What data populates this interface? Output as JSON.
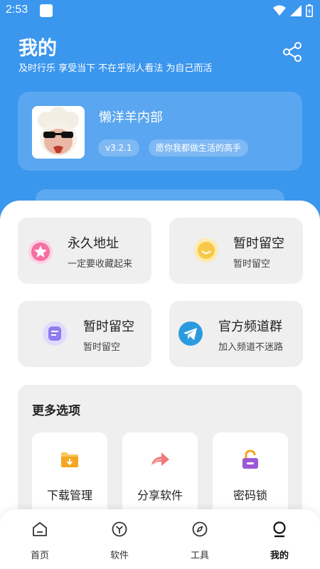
{
  "status_bar": {
    "time": "2:53"
  },
  "header": {
    "title": "我的",
    "subtitle": "及时行乐 享受当下 不在乎别人看法 为自己而活"
  },
  "profile": {
    "name": "懒洋羊内部",
    "version": "v3.2.1",
    "motto": "愿你我都做生活的高手"
  },
  "feature_cards": [
    {
      "title": "永久地址",
      "subtitle": "一定要收藏起来",
      "icon": "star-icon",
      "color": "#f56fa0"
    },
    {
      "title": "暂时留空",
      "subtitle": "暂时留空",
      "icon": "smile-icon",
      "color": "#f7c948"
    },
    {
      "title": "暂时留空",
      "subtitle": "暂时留空",
      "icon": "note-icon",
      "color": "#8e7cf0"
    },
    {
      "title": "官方频道群",
      "subtitle": "加入频道不迷路",
      "icon": "telegram-icon",
      "color": "#2b9be0"
    }
  ],
  "more_options": {
    "title": "更多选项",
    "items": [
      {
        "label": "下载管理",
        "icon": "folder-download-icon",
        "color": "#f5a623"
      },
      {
        "label": "分享软件",
        "icon": "share-arrow-icon",
        "color": "#f07a7a"
      },
      {
        "label": "密码锁",
        "icon": "lock-icon",
        "color": "#9b59d6"
      }
    ]
  },
  "bottom_nav": {
    "items": [
      {
        "label": "首页",
        "icon": "home-icon",
        "active": false
      },
      {
        "label": "软件",
        "icon": "apps-icon",
        "active": false
      },
      {
        "label": "工具",
        "icon": "compass-icon",
        "active": false
      },
      {
        "label": "我的",
        "icon": "profile-icon",
        "active": true
      }
    ]
  },
  "colors": {
    "brand": "#3b96ee",
    "card_bg": "#efefef"
  }
}
